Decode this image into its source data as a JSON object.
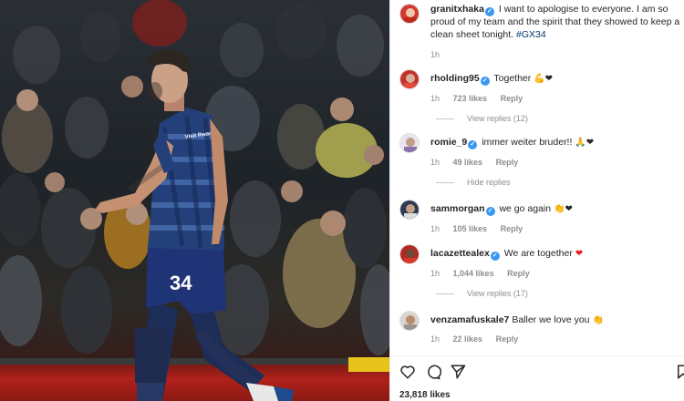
{
  "post": {
    "author": "granitxhaka",
    "caption": "I want to apologise to everyone. I am so proud of my team and the spirit that they showed to keep a clean sheet tonight.",
    "hashtag": "#GX34",
    "time": "1h",
    "likes": "23,818 likes",
    "kit": {
      "sponsor": "Visit Rwanda",
      "number": "34"
    }
  },
  "comments": [
    {
      "user": "rholding95",
      "text": "Together",
      "emoji": "💪❤",
      "time": "1h",
      "likes": "723 likes",
      "reply": "Reply",
      "replies": "View replies (12)"
    },
    {
      "user": "romie_9",
      "text": "immer weiter bruder!!",
      "emoji": "🙏❤",
      "time": "1h",
      "likes": "49 likes",
      "reply": "Reply",
      "replies": "Hide replies"
    },
    {
      "user": "sammorgan",
      "text": "we go again",
      "emoji": "👏❤",
      "time": "1h",
      "likes": "105 likes",
      "reply": "Reply"
    },
    {
      "user": "lacazettealex",
      "text": "We are together",
      "emoji": "❤",
      "time": "1h",
      "likes": "1,044 likes",
      "reply": "Reply",
      "replies": "View replies (17)"
    },
    {
      "user": "venzamafuskale7",
      "text": "Baller we love you",
      "emoji": "👏",
      "time": "1h",
      "likes": "22 likes",
      "reply": "Reply"
    }
  ],
  "icons": [
    "heart-icon",
    "comment-icon",
    "share-icon",
    "bookmark-icon"
  ],
  "colors": {
    "verified": "#3897f0",
    "hashtag": "#00376b",
    "heart": "#ed1c24",
    "muted": "#8e8e8e"
  }
}
